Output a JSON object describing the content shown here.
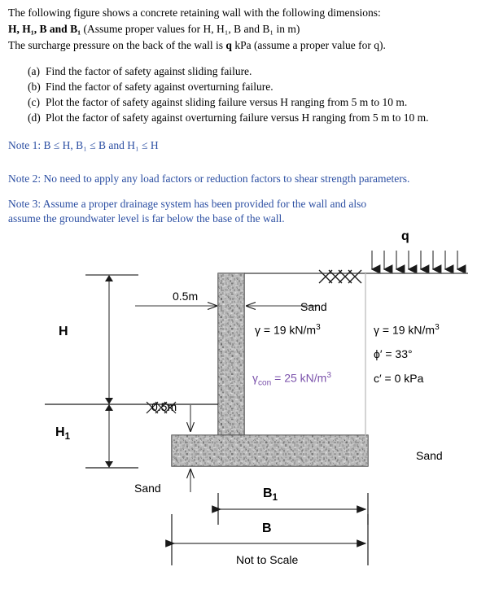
{
  "statement": {
    "line1": "The following figure shows a concrete retaining wall with the following dimensions:",
    "line2_bold": "H, H₁, B and B₁",
    "line2_rest": " (Assume proper values for H, H₁, B and B₁ in m)",
    "line3_pre": "The surcharge pressure on the back of the wall is ",
    "line3_bold": "q",
    "line3_post": " kPa (assume a proper value for q).",
    "items": [
      {
        "label": "(a)",
        "text": "Find the factor of safety against sliding failure."
      },
      {
        "label": "(b)",
        "text": "Find the factor of safety against overturning failure."
      },
      {
        "label": "(c)",
        "text": "Plot the factor of safety against sliding failure versus H ranging from 5 m to 10 m."
      },
      {
        "label": "(d)",
        "text": "Plot the factor of safety against overturning failure versus H ranging from 5 m to 10 m."
      }
    ]
  },
  "notes": {
    "note1": "Note 1: B ≤ H,    B₁ ≤ B    and    H₁ ≤ H",
    "note2": "Note 2: No need to apply any load factors or reduction factors to shear strength parameters.",
    "note3": "Note 3: Assume a proper drainage system has been provided for the wall and also assume the groundwater level is far below the base of the wall.",
    "color": "#2b4ea2"
  },
  "figure": {
    "surcharge_label": "q",
    "stem_thickness_label": "0.5m",
    "base_thickness_label": "0.5m",
    "height_label": "H",
    "embedment_label": "H₁",
    "base_width_label": "B",
    "heel_width_label": "B₁",
    "sand_label_backfill": "Sand",
    "sand_label_right": "Sand",
    "sand_label_left": "Sand",
    "soil_unit_weight_left": "γ = 19 kN/m³",
    "concrete_unit_weight": "γcon = 25 kN/m³",
    "soil_unit_weight_right": "γ = 19 kN/m³",
    "friction_angle": "ϕ′ = 33°",
    "cohesion": "c′ = 0 kPa",
    "scale_note": "Not to Scale",
    "concrete_color": "#9a9a9a",
    "concrete_gamma_color": "#7b52ab",
    "n_surcharge_arrows": 8
  }
}
